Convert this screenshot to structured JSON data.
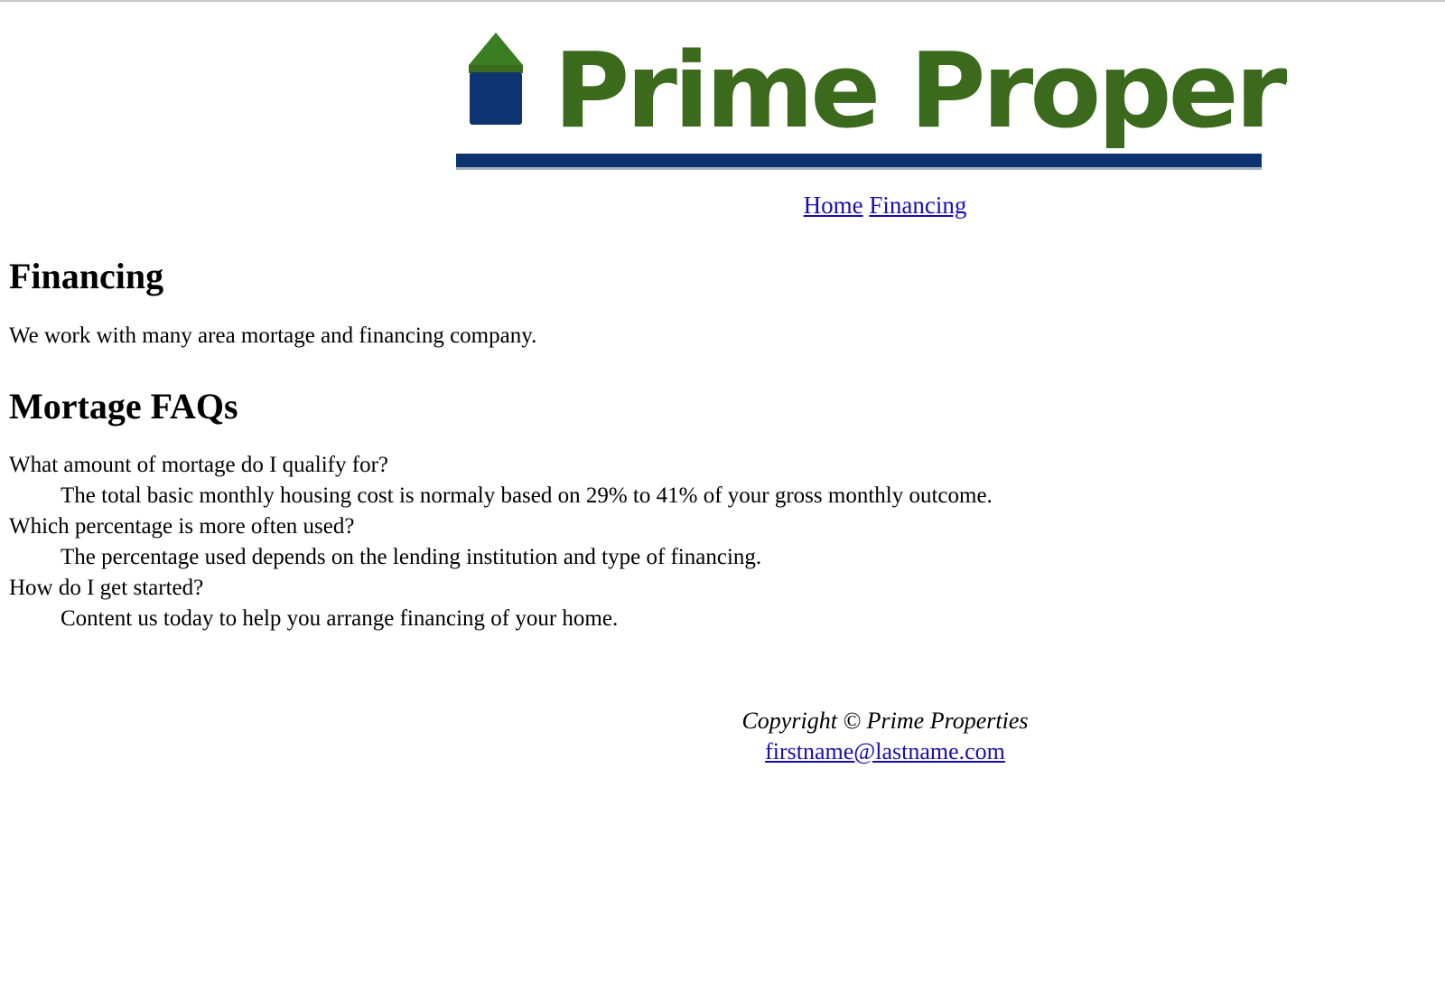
{
  "header": {
    "logo_text": "Prime Properties",
    "logo_icon": "house-icon",
    "colors": {
      "logo_green": "#3b6a1c",
      "logo_navy": "#0d3470",
      "link": "#1a0dab"
    }
  },
  "nav": {
    "home_label": "Home",
    "financing_label": "Financing"
  },
  "main": {
    "title": "Financing",
    "intro": "We work with many area mortage and financing company.",
    "faq_title": "Mortage FAQs",
    "faqs": [
      {
        "question": "What amount of mortage do I qualify for?",
        "answer": "The total basic monthly housing cost is normaly based on 29% to 41% of your gross monthly outcome."
      },
      {
        "question": "Which percentage is more often used?",
        "answer": "The percentage used depends on the lending institution and type of financing."
      },
      {
        "question": "How do I get started?",
        "answer": "Content us today to help you arrange financing of your home."
      }
    ]
  },
  "footer": {
    "copyright": "Copyright © Prime Properties",
    "email": "firstname@lastname.com"
  }
}
